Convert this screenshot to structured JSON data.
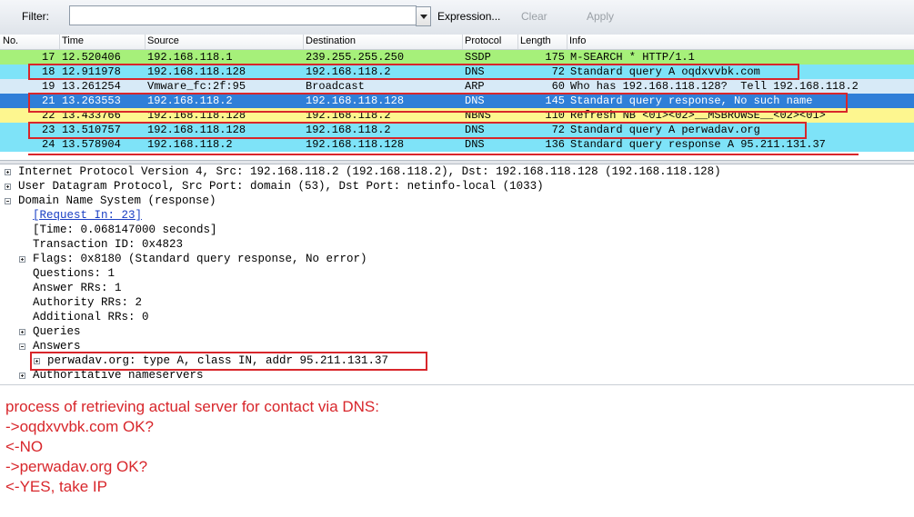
{
  "toolbar": {
    "filter_label": "Filter:",
    "filter_value": "",
    "expression_label": "Expression...",
    "clear_label": "Clear",
    "apply_label": "Apply"
  },
  "packet_list": {
    "columns": [
      "No.",
      "Time",
      "Source",
      "Destination",
      "Protocol",
      "Length",
      "Info"
    ],
    "rows": [
      {
        "no": "17",
        "time": "12.520406",
        "src": "192.168.118.1",
        "dst": "239.255.255.250",
        "proto": "SSDP",
        "len": "175",
        "info": "M-SEARCH * HTTP/1.1",
        "bg": "#a6f07a"
      },
      {
        "no": "18",
        "time": "12.911978",
        "src": "192.168.118.128",
        "dst": "192.168.118.2",
        "proto": "DNS",
        "len": "72",
        "info": "Standard query A oqdxvvbk.com",
        "bg": "#7ee3f8"
      },
      {
        "no": "19",
        "time": "13.261254",
        "src": "Vmware_fc:2f:95",
        "dst": "Broadcast",
        "proto": "ARP",
        "len": "60",
        "info": "Who has 192.168.118.128?  Tell 192.168.118.2",
        "bg": "#d7eaf7"
      },
      {
        "no": "21",
        "time": "13.263553",
        "src": "192.168.118.2",
        "dst": "192.168.118.128",
        "proto": "DNS",
        "len": "145",
        "info": "Standard query response, No such name",
        "bg": "#2f7fd8",
        "fg": "#ffffff"
      },
      {
        "no": "22",
        "time": "13.433766",
        "src": "192.168.118.128",
        "dst": "192.168.118.2",
        "proto": "NBNS",
        "len": "110",
        "info": "Refresh NB <01><02>__MSBROWSE__<02><01>",
        "bg": "#fdf68f"
      },
      {
        "no": "23",
        "time": "13.510757",
        "src": "192.168.118.128",
        "dst": "192.168.118.2",
        "proto": "DNS",
        "len": "72",
        "info": "Standard query A perwadav.org",
        "bg": "#7ee3f8"
      },
      {
        "no": "24",
        "time": "13.578904",
        "src": "192.168.118.2",
        "dst": "192.168.118.128",
        "proto": "DNS",
        "len": "136",
        "info": "Standard query response A 95.211.131.37",
        "bg": "#7ee3f8"
      }
    ]
  },
  "details": {
    "ip_line": "Internet Protocol Version 4, Src: 192.168.118.2 (192.168.118.2), Dst: 192.168.118.128 (192.168.118.128)",
    "udp_line": "User Datagram Protocol, Src Port: domain (53), Dst Port: netinfo-local (1033)",
    "dns_line": "Domain Name System (response)",
    "request_in": "[Request In: 23]",
    "time": "[Time: 0.068147000 seconds]",
    "transaction": "Transaction ID: 0x4823",
    "flags": "Flags: 0x8180 (Standard query response, No error)",
    "questions": "Questions: 1",
    "answer_rrs": "Answer RRs: 1",
    "authority_rrs": "Authority RRs: 2",
    "additional_rrs": "Additional RRs: 0",
    "queries": "Queries",
    "answers": "Answers",
    "answer_entry": "perwadav.org: type A, class IN, addr 95.211.131.37",
    "auth_ns": "Authoritative nameservers"
  },
  "annotation": {
    "line1": "process of retrieving actual server for contact via DNS:",
    "line2": "->oqdxvvbk.com OK?",
    "line3": "<-NO",
    "line4": "->perwadav.org OK?",
    "line5": "<-YES, take IP"
  },
  "colors": {
    "highlight": "#d8262b",
    "selected_row": "#2f7fd8",
    "dns_row": "#7ee3f8",
    "ssdp_row": "#a6f07a",
    "nbns_row": "#fdf68f",
    "arp_row": "#d7eaf7"
  }
}
